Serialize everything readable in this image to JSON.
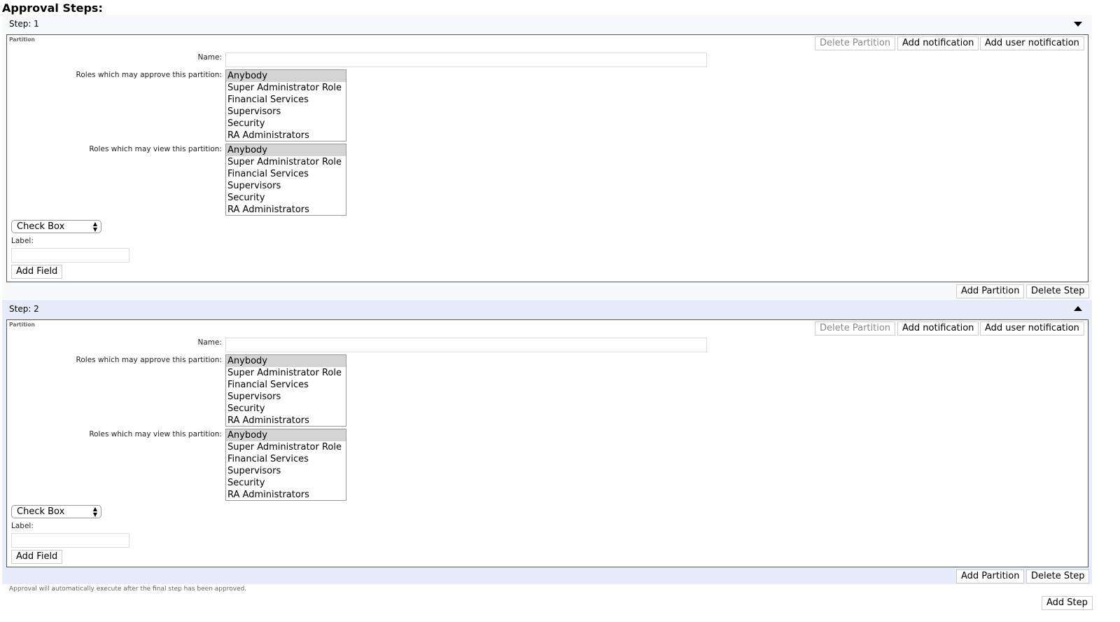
{
  "title": "Approval Steps:",
  "steps": [
    {
      "label": "Step: 1",
      "expanded": false,
      "background": "#f7f9fd",
      "partition": {
        "legend": "Partition",
        "buttons": {
          "delete_partition": "Delete Partition",
          "add_notification": "Add notification",
          "add_user_notification": "Add user notification"
        },
        "name_label": "Name:",
        "name_value": "",
        "approve_label": "Roles which may approve this partition:",
        "view_label": "Roles which may view this partition:",
        "roles": [
          "Anybody",
          "Super Administrator Role",
          "Financial Services",
          "Supervisors",
          "Security",
          "RA Administrators"
        ],
        "approve_selected": "Anybody",
        "view_selected": "Anybody",
        "field_type": "Check Box",
        "label_label": "Label:",
        "label_value": "",
        "add_field": "Add Field"
      },
      "add_partition": "Add Partition",
      "delete_step": "Delete Step"
    },
    {
      "label": "Step: 2",
      "expanded": true,
      "background": "#e6ecfa",
      "partition": {
        "legend": "Partition",
        "buttons": {
          "delete_partition": "Delete Partition",
          "add_notification": "Add notification",
          "add_user_notification": "Add user notification"
        },
        "name_label": "Name:",
        "name_value": "",
        "approve_label": "Roles which may approve this partition:",
        "view_label": "Roles which may view this partition:",
        "roles": [
          "Anybody",
          "Super Administrator Role",
          "Financial Services",
          "Supervisors",
          "Security",
          "RA Administrators"
        ],
        "approve_selected": "Anybody",
        "view_selected": "Anybody",
        "field_type": "Check Box",
        "label_label": "Label:",
        "label_value": "",
        "add_field": "Add Field"
      },
      "add_partition": "Add Partition",
      "delete_step": "Delete Step"
    }
  ],
  "footer_note": "Approval will automatically execute after the final step has been approved.",
  "add_step": "Add Step"
}
